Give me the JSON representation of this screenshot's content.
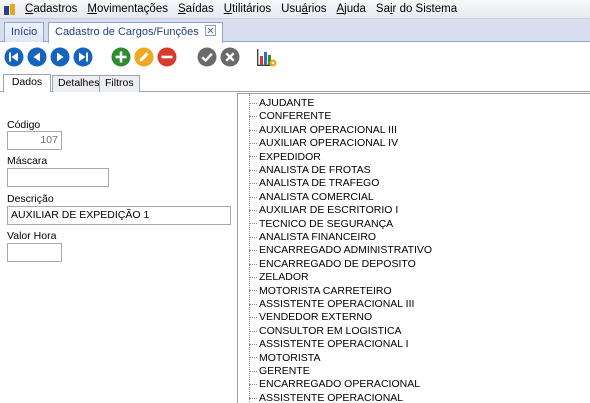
{
  "menu": {
    "items": [
      {
        "pre": "",
        "u": "C",
        "post": "adastros"
      },
      {
        "pre": "",
        "u": "M",
        "post": "ovimentações"
      },
      {
        "pre": "",
        "u": "S",
        "post": "aídas"
      },
      {
        "pre": "",
        "u": "U",
        "post": "tilitários"
      },
      {
        "pre": "Usu",
        "u": "á",
        "post": "rios"
      },
      {
        "pre": "",
        "u": "A",
        "post": "juda"
      },
      {
        "pre": "Sa",
        "u": "i",
        "post": "r do Sistema"
      }
    ]
  },
  "tabs": {
    "inicio": "Início",
    "cadastro": "Cadastro de Cargos/Funções"
  },
  "toolbar": {
    "icons": [
      "first-icon",
      "previous-icon",
      "next-icon",
      "last-icon",
      "add-icon",
      "edit-icon",
      "delete-icon",
      "confirm-icon",
      "cancel-icon",
      "report-icon"
    ],
    "colors": {
      "nav": "#1565c0",
      "add": "#2e8b2e",
      "edit": "#f2a81d",
      "delete": "#d93a2b",
      "gray": "#6a6a6a"
    }
  },
  "subtabs": [
    "Dados",
    "Detalhes",
    "Filtros"
  ],
  "form": {
    "codigo_label": "Código",
    "codigo_value": "107",
    "mascara_label": "Máscara",
    "mascara_value": "",
    "descricao_label": "Descrição",
    "descricao_value": "AUXILIAR DE EXPEDIÇÃO 1",
    "valor_hora_label": "Valor Hora",
    "valor_hora_value": ""
  },
  "tree": {
    "items": [
      "AJUDANTE",
      "CONFERENTE",
      "AUXILIAR OPERACIONAL III",
      "AUXILIAR OPERACIONAL IV",
      "EXPEDIDOR",
      "ANALISTA DE FROTAS",
      "ANALISTA DE TRAFEGO",
      "ANALISTA COMERCIAL",
      "AUXILIAR DE ESCRITORIO I",
      "TECNICO DE SEGURANÇA",
      "ANALISTA FINANCEIRO",
      "ENCARREGADO ADMINISTRATIVO",
      "ENCARREGADO DE DEPOSITO",
      "ZELADOR",
      "MOTORISTA CARRETEIRO",
      "ASSISTENTE OPERACIONAL III",
      "VENDEDOR EXTERNO",
      "CONSULTOR EM LOGISTICA",
      "ASSISTENTE OPERACIONAL I",
      "MOTORISTA",
      "GERENTE",
      "ENCARREGADO OPERACIONAL",
      "ASSISTENTE OPERACIONAL"
    ]
  }
}
